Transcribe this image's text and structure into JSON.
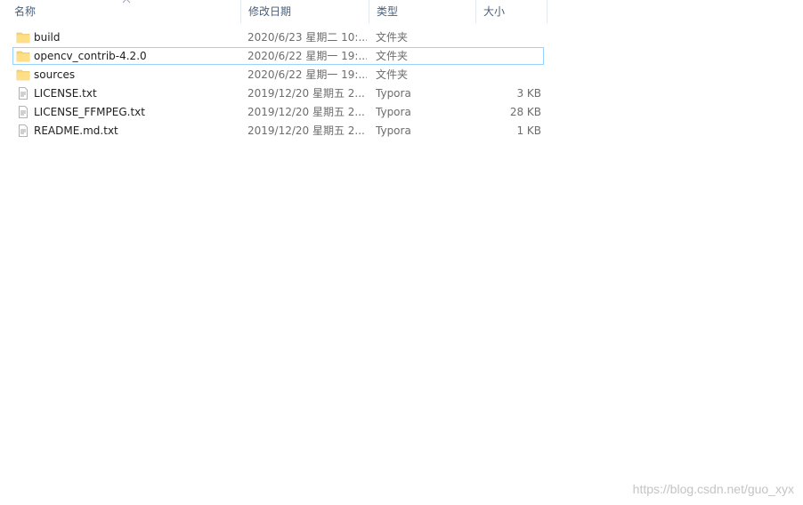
{
  "columns": {
    "name": "名称",
    "date": "修改日期",
    "type": "类型",
    "size": "大小"
  },
  "files": [
    {
      "name": "build",
      "date": "2020/6/23 星期二 10:...",
      "type": "文件夹",
      "size": "",
      "icon": "folder-icon"
    },
    {
      "name": "opencv_contrib-4.2.0",
      "date": "2020/6/22 星期一 19:...",
      "type": "文件夹",
      "size": "",
      "icon": "folder-icon",
      "selected": true
    },
    {
      "name": "sources",
      "date": "2020/6/22 星期一 19:...",
      "type": "文件夹",
      "size": "",
      "icon": "folder-icon"
    },
    {
      "name": "LICENSE.txt",
      "date": "2019/12/20 星期五 2...",
      "type": "Typora",
      "size": "3 KB",
      "icon": "text-file-icon"
    },
    {
      "name": "LICENSE_FFMPEG.txt",
      "date": "2019/12/20 星期五 2...",
      "type": "Typora",
      "size": "28 KB",
      "icon": "text-file-icon"
    },
    {
      "name": "README.md.txt",
      "date": "2019/12/20 星期五 2...",
      "type": "Typora",
      "size": "1 KB",
      "icon": "text-file-icon"
    }
  ],
  "watermark": "https://blog.csdn.net/guo_xyx",
  "colors": {
    "folder": "#f8d775",
    "selection_border": "#99d1ff",
    "header_text": "#4c607a"
  }
}
